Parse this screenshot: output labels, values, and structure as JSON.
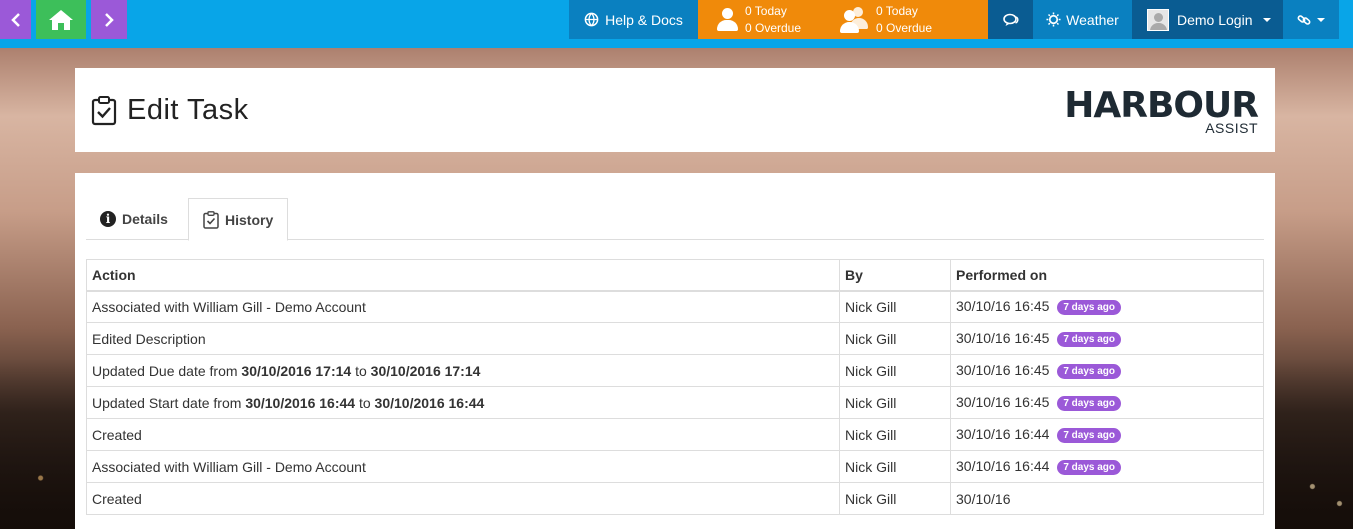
{
  "topbar": {
    "back_icon": "chevron-left-icon",
    "home_icon": "home-icon",
    "forward_icon": "chevron-right-icon",
    "help_label": "Help & Docs",
    "my_tasks": {
      "today": "0 Today",
      "overdue": "0 Overdue"
    },
    "team_tasks": {
      "today": "0 Today",
      "overdue": "0 Overdue"
    },
    "weather_label": "Weather",
    "login_label": "Demo Login",
    "colors": {
      "bar": "#08a5e8",
      "orange": "#f08a0a",
      "purple": "#9b59d8",
      "green": "#3dbf5a"
    }
  },
  "header": {
    "title": "Edit Task",
    "logo_main": "HARBOUR",
    "logo_sub": "ASSIST"
  },
  "tabs": [
    {
      "label": "Details",
      "icon": "info-icon",
      "active": false
    },
    {
      "label": "History",
      "icon": "clipboard-check-icon",
      "active": true
    }
  ],
  "history": {
    "columns": [
      "Action",
      "By",
      "Performed on"
    ],
    "rows": [
      {
        "action": "Associated with William Gill - Demo Account",
        "by": "Nick Gill",
        "performed": "30/10/16 16:45",
        "ago": "7 days ago"
      },
      {
        "action": "Edited Description",
        "by": "Nick Gill",
        "performed": "30/10/16 16:45",
        "ago": "7 days ago"
      },
      {
        "action_prefix": "Updated Due date from ",
        "from": "30/10/2016 17:14",
        "to_word": " to ",
        "to": "30/10/2016 17:14",
        "by": "Nick Gill",
        "performed": "30/10/16 16:45",
        "ago": "7 days ago"
      },
      {
        "action_prefix": "Updated Start date from ",
        "from": "30/10/2016 16:44",
        "to_word": " to ",
        "to": "30/10/2016 16:44",
        "by": "Nick Gill",
        "performed": "30/10/16 16:45",
        "ago": "7 days ago"
      },
      {
        "action": "Created",
        "by": "Nick Gill",
        "performed": "30/10/16 16:44",
        "ago": "7 days ago"
      },
      {
        "action": "Associated with William Gill - Demo Account",
        "by": "Nick Gill",
        "performed": "30/10/16 16:44",
        "ago": "7 days ago"
      },
      {
        "action": "Created",
        "by": "Nick Gill",
        "performed": "30/10/16",
        "ago": ""
      }
    ]
  }
}
